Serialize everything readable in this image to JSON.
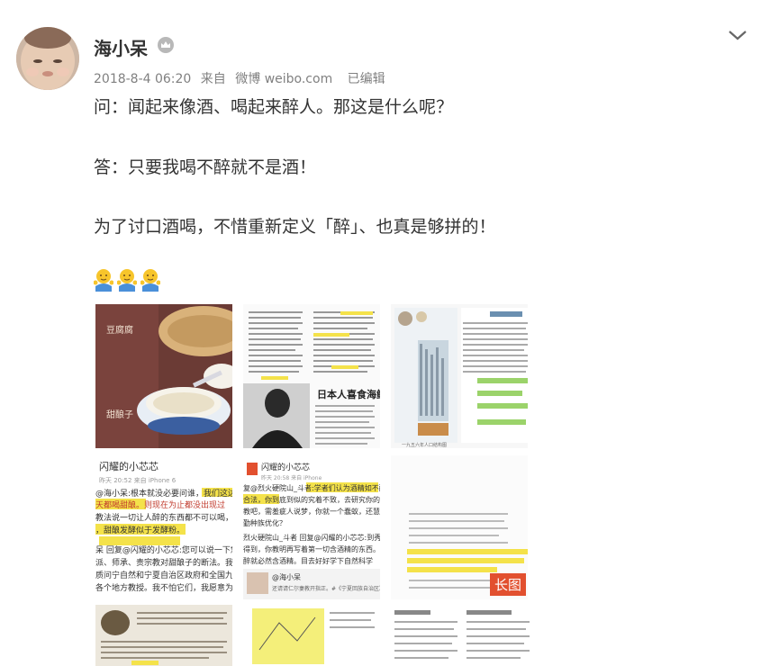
{
  "user": {
    "name": "海小呆"
  },
  "meta": {
    "date": "2018-8-4 06:20",
    "source_prefix": "来自",
    "source": "微博 weibo.com",
    "edited": "已编辑"
  },
  "post": {
    "line1": "问：闻起来像酒、喝起来醉人。那这是什么呢？",
    "line2": "答：只要我喝不醉就不是酒！",
    "line3": "为了讨口酒喝，不惜重新定义「醉」、也真是够拼的！"
  },
  "emojis": [
    "shrug-emoji",
    "shrug-emoji",
    "shrug-emoji"
  ],
  "images": {
    "img1": {
      "label_top": "豆腐腐",
      "label_bottom": "甜酿子"
    },
    "img2": {
      "title": "日本人喜食海鲜"
    },
    "img3": {
      "caption": "一九五六年人口结构图"
    },
    "img4": {
      "name": "闪耀的小芯芯",
      "time": "昨天 20:52 来自 iPhone 6",
      "p1": "@海小呆:根本就没必要问谁，我们这边",
      "p1b": "天都喝甜酿。则现在为止都没出现过",
      "p1c": "教法说一切让人醉的东西都不可以喝，",
      "p1d": "，甜酿发酵似于发酵粉。",
      "p2": "呆 回复@闪耀的小芯芯:您可以说一下您的",
      "p2b": "派、师承、责宗教对甜酿子的断法。我可",
      "p2c": "质问宁自然和宁夏自治区政府和全国九省",
      "p2d": "各个地方教授。我不怕它们，我愿意为您"
    },
    "img5": {
      "name": "闪耀的小芯芯",
      "time": "昨天 20:58 来自 iPhone",
      "p1": "复@烈火硬院山_斗者:学者们认为酒精如不醉人",
      "p1b": "合法，你到底到似的究着不致，去研究你的看",
      "p1c": "教吧，需羞疵人说梦，你就一个蠢蚁，还慧学",
      "p1d": "勤种族优化？",
      "p2": "烈火硬院山_斗者 回复@闪耀的小芯芯:到秀你的智",
      "p2b": "得到，你教明再写着第一切含酒精的东西。任何",
      "p2c": "醉就必然含酒精。目去好好学下自然科学",
      "quote_user": "@海小呆",
      "quote_text": "还请请仁尔妻教开指正。#《宁夏回族自治区》"
    },
    "img6": {
      "badge": "长图"
    },
    "img7": {},
    "img8": {},
    "img9": {}
  }
}
